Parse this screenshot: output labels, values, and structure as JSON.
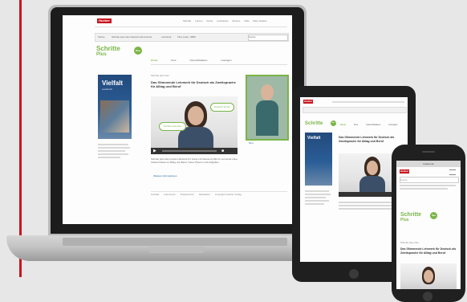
{
  "brand": {
    "logo": "Hueber",
    "color": "#c8151e"
  },
  "nav": {
    "items": [
      "Schritte",
      "Lernen",
      "Kurse",
      "Lehrwerke",
      "Service",
      "Hilfe",
      "Mein Hueber"
    ]
  },
  "filter": {
    "button": "Suche",
    "dropdown": "Schritte plus Neu Deutsch als Fremdsprache",
    "label": "Lehrwerk",
    "placeholder": "Titel, Autor, ISBN",
    "search_placeholder": "Suche"
  },
  "logo": {
    "text1": "Schritte",
    "text2": "Plus",
    "badge": "Neu"
  },
  "tabs": [
    "Home",
    "Kurs",
    "Unterrichtsideen",
    "Lösungen"
  ],
  "book": {
    "title": "Vielfalt",
    "subtitle": "Lesebuch"
  },
  "breadcrumb": "Schritte plus Neu",
  "article": {
    "headline": "Das Glimmende Lehrwerk für Deutsch als Zweitsprache für Alltag und Beruf",
    "bubble1": "Schritte plus Neu",
    "bubble2": "Deutsch lernen",
    "body": "Schritte plus Neu ist das Lehrwerk für Kurse mit Niveau A1-B1 für Lernende ohne Vorkenntnisse im Alltag und Beruf. Neue Themen und Aufgaben.",
    "link": "Weitere Informationen"
  },
  "sidebar": {
    "caption": "Schritte plus Neu im Überblick: Kursbuch, Arbeitsbuch und Lehrerhandbuch für die Niveaustufen A1 bis B1",
    "link": "mehr erfahren",
    "more": "Neu"
  },
  "footer": {
    "items": [
      "Kontakt",
      "Impressum",
      "Datenschutz",
      "Newsletter",
      "Copyright Hueber Verlag"
    ]
  },
  "phone": {
    "url": "hueber.de"
  }
}
